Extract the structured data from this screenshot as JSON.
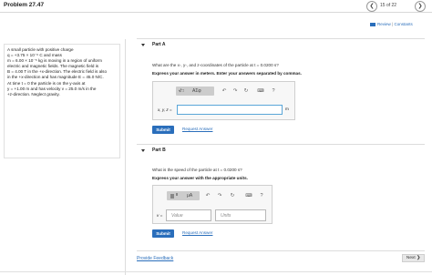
{
  "header": {
    "title": "Problem 27.47",
    "page_count": "15 of 22",
    "prev_icon": "chevron-left-icon",
    "next_icon": "chevron-right-icon"
  },
  "links": {
    "review": "Review",
    "separator": "|",
    "constants": "Constants"
  },
  "problem": {
    "lines": [
      "A small particle with positive charge",
      "q = +3.75 × 10⁻⁶ C and mass",
      "m = 6.00 × 10⁻⁵ kg is moving in a region of uniform",
      "electric and magnetic fields. The magnetic field is",
      "B = 4.00 T in the +x-direction. The electric field is also",
      "in the +x-direction and has magnitude E = 45.0 N/C.",
      "At time t = 0 the particle is on the y-axis at",
      "y = +1.00 m and has velocity v = 25.0 m/s in the",
      "+z-direction. Neglect gravity."
    ]
  },
  "part_a": {
    "heading": "Part A",
    "question": "What are the x-, y-, and z-coordinates of the particle at t = 0.0200 s?",
    "instruction": "Express your answer in meters. Enter your answers separated by commas.",
    "toolbar": {
      "template_label": "√□",
      "greek_label": "AΣφ",
      "undo_icon": "undo-icon",
      "redo_icon": "redo-icon",
      "reset_icon": "reset-icon",
      "keyboard_icon": "keyboard-icon",
      "help_label": "?"
    },
    "input_label": "x, y, z =",
    "input_value": "",
    "unit": "m",
    "submit_label": "Submit",
    "request_label": "Request Answer"
  },
  "part_b": {
    "heading": "Part B",
    "question": "What is the speed of the particle at t = 0.0200 s?",
    "instruction": "Express your answer with the appropriate units.",
    "toolbar": {
      "template_label": "□",
      "units_label": "μA",
      "undo_icon": "undo-icon",
      "redo_icon": "redo-icon",
      "reset_icon": "reset-icon",
      "keyboard_icon": "keyboard-icon",
      "help_label": "?"
    },
    "input_label": "v =",
    "value_placeholder": "Value",
    "units_placeholder": "Units",
    "submit_label": "Submit",
    "request_label": "Request Answer"
  },
  "footer": {
    "feedback": "Provide Feedback",
    "next_label": "Next ❯"
  },
  "colors": {
    "accent": "#2a6ebb",
    "toolbar": "#cccccc",
    "input_focus": "#5aa6d8"
  }
}
